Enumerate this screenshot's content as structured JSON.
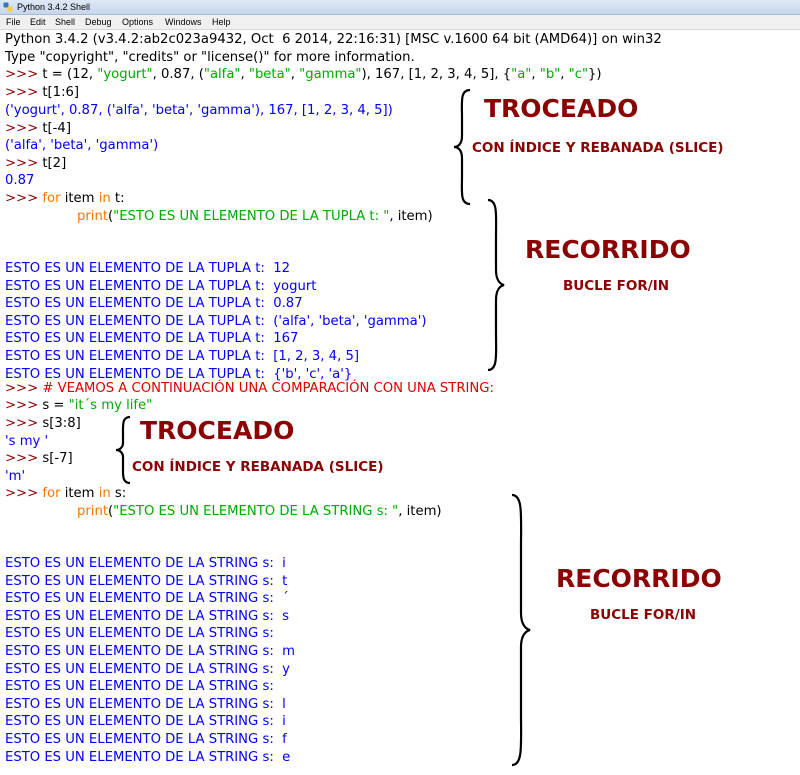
{
  "window": {
    "title": "Python 3.4.2 Shell"
  },
  "menu": [
    "File",
    "Edit",
    "Shell",
    "Debug",
    "Options",
    "Windows",
    "Help"
  ],
  "shell": {
    "prompt": ">>>",
    "banner": "Python 3.4.2 (v3.4.2:ab2c023a9432, Oct  6 2014, 22:16:31) [MSC v.1600 64 bit (AMD64)] on win32",
    "info": "Type \"copyright\", \"credits\" or \"license()\" for more information.",
    "cmd_tuple": "t = (12, \"yogurt\", 0.87, (\"alfa\", \"beta\", \"gamma\"), 167, [1, 2, 3, 4, 5], {\"a\", \"b\", \"c\"})",
    "cmd_slice1": "t[1:6]",
    "out_slice1": "('yogurt', 0.87, ('alfa', 'beta', 'gamma'), 167, [1, 2, 3, 4, 5])",
    "cmd_index_neg": "t[-4]",
    "out_index_neg": "('alfa', 'beta', 'gamma')",
    "cmd_index2": "t[2]",
    "out_index2": "0.87",
    "for_kw": "for",
    "in_kw": "in",
    "for_item": " item ",
    "for_tail_t": " t:",
    "print_kw": "print",
    "print_open": "(",
    "print_str_t": "\"ESTO ES UN ELEMENTO DE LA TUPLA t: \"",
    "print_close": ", item)",
    "tuple_out_prefix": "ESTO ES UN ELEMENTO DE LA TUPLA t:  ",
    "tuple_items": [
      "12",
      "yogurt",
      "0.87",
      "('alfa', 'beta', 'gamma')",
      "167",
      "[1, 2, 3, 4, 5]",
      "{'b', 'c', 'a'}"
    ],
    "comment": "# VEAMOS A CONTINUACIÓN UNA COMPARACIÓN CON UNA STRING:",
    "cmd_string_lhs": "s = ",
    "cmd_string_val": "\"it´s my life\"",
    "cmd_s_slice": "s[3:8]",
    "out_s_slice": "'s my '",
    "cmd_s_index": "s[-7]",
    "out_s_index": "'m'",
    "for_tail_s": " s:",
    "print_str_s": "\"ESTO ES UN ELEMENTO DE LA STRING s: \"",
    "string_out_prefix": "ESTO ES UN ELEMENTO DE LA STRING s:  ",
    "string_items": [
      "i",
      "t",
      "´",
      "s",
      "",
      "m",
      "y",
      "",
      "l",
      "i",
      "f",
      "e"
    ]
  },
  "annotations": {
    "troceado_1": "TROCEADO",
    "troceado_1_sub": "CON ÍNDICE Y REBANADA (SLICE)",
    "recorrido_1": "RECORRIDO",
    "recorrido_1_sub": "BUCLE FOR/IN",
    "troceado_2": "TROCEADO",
    "troceado_2_sub": "CON ÍNDICE Y REBANADA (SLICE)",
    "recorrido_2": "RECORRIDO",
    "recorrido_2_sub": "BUCLE FOR/IN"
  },
  "colors": {
    "prompt": "#8b0000",
    "keyword": "#ff7700",
    "string": "#00aa00",
    "output": "#0000ff",
    "comment": "#dd0000",
    "annotation": "#8b0000"
  }
}
